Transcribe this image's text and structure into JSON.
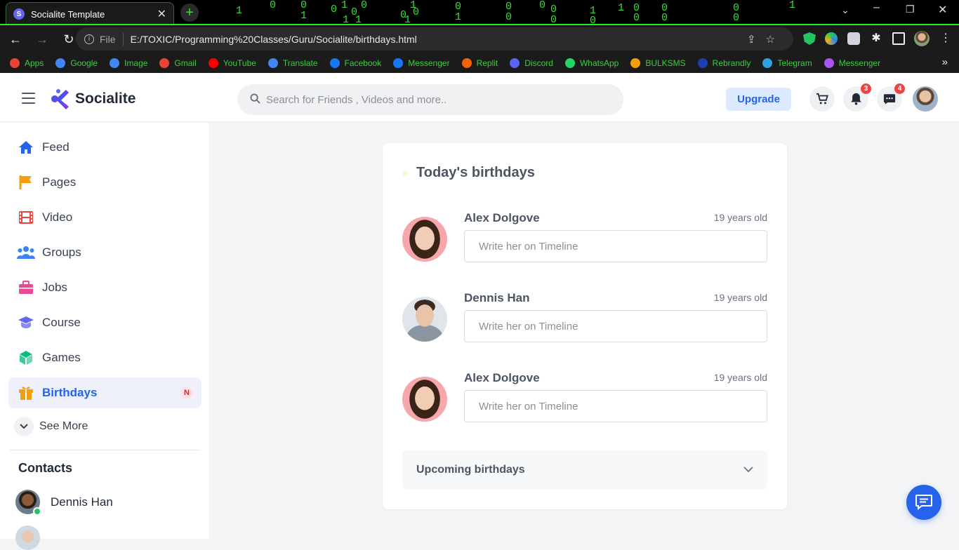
{
  "browser": {
    "tab_title": "Socialite Template",
    "tab_favicon": "S",
    "url_scheme": "File",
    "url": "E:/TOXIC/Programming%20Classes/Guru/Socialite/birthdays.html",
    "bookmarks": [
      {
        "label": "Apps",
        "icon": "apps-grid-icon",
        "color": "#ea4335"
      },
      {
        "label": "Google",
        "icon": "google-icon",
        "color": "#4285f4"
      },
      {
        "label": "Image",
        "icon": "google-icon",
        "color": "#4285f4"
      },
      {
        "label": "Gmail",
        "icon": "gmail-icon",
        "color": "#ea4335"
      },
      {
        "label": "YouTube",
        "icon": "youtube-icon",
        "color": "#ff0000"
      },
      {
        "label": "Translate",
        "icon": "translate-icon",
        "color": "#4285f4"
      },
      {
        "label": "Facebook",
        "icon": "facebook-icon",
        "color": "#1877f2"
      },
      {
        "label": "Messenger",
        "icon": "facebook-icon",
        "color": "#1877f2"
      },
      {
        "label": "Replit",
        "icon": "replit-icon",
        "color": "#f26207"
      },
      {
        "label": "Discord",
        "icon": "discord-icon",
        "color": "#5865f2"
      },
      {
        "label": "WhatsApp",
        "icon": "whatsapp-icon",
        "color": "#25d366"
      },
      {
        "label": "BULKSMS",
        "icon": "bulksms-icon",
        "color": "#f59e0b"
      },
      {
        "label": "Rebrandly",
        "icon": "rebrandly-icon",
        "color": "#1e40af"
      },
      {
        "label": "Telegram",
        "icon": "telegram-icon",
        "color": "#2aa3df"
      },
      {
        "label": "Messenger",
        "icon": "messenger-icon",
        "color": "#a855f7"
      }
    ]
  },
  "header": {
    "brand": "Socialite",
    "search_placeholder": "Search for Friends , Videos and more..",
    "upgrade_label": "Upgrade",
    "notifications_count": "3",
    "messages_count": "4",
    "accent_color": "#2563eb"
  },
  "sidebar": {
    "items": [
      {
        "label": "Feed",
        "icon": "home-icon",
        "color": "#2563eb"
      },
      {
        "label": "Pages",
        "icon": "flag-icon",
        "color": "#f59e0b"
      },
      {
        "label": "Video",
        "icon": "film-icon",
        "color": "#ef4444"
      },
      {
        "label": "Groups",
        "icon": "users-icon",
        "color": "#3b82f6"
      },
      {
        "label": "Jobs",
        "icon": "briefcase-icon",
        "color": "#ec4899"
      },
      {
        "label": "Course",
        "icon": "graduation-cap-icon",
        "color": "#6366f1"
      },
      {
        "label": "Games",
        "icon": "cube-icon",
        "color": "#10b981"
      },
      {
        "label": "Birthdays",
        "icon": "gift-icon",
        "color": "#f59e0b",
        "badge": "N"
      }
    ],
    "see_more_label": "See More",
    "contacts_title": "Contacts",
    "contacts": [
      {
        "name": "Dennis Han",
        "online": true
      }
    ]
  },
  "main": {
    "title": "Today's birthdays",
    "birthdays": [
      {
        "name": "Alex Dolgove",
        "age": "19 years old",
        "placeholder": "Write her on Timeline"
      },
      {
        "name": "Dennis Han",
        "age": "19 years old",
        "placeholder": "Write her on Timeline"
      },
      {
        "name": "Alex Dolgove",
        "age": "19 years old",
        "placeholder": "Write her on Timeline"
      }
    ],
    "upcoming_label": "Upcoming birthdays"
  }
}
